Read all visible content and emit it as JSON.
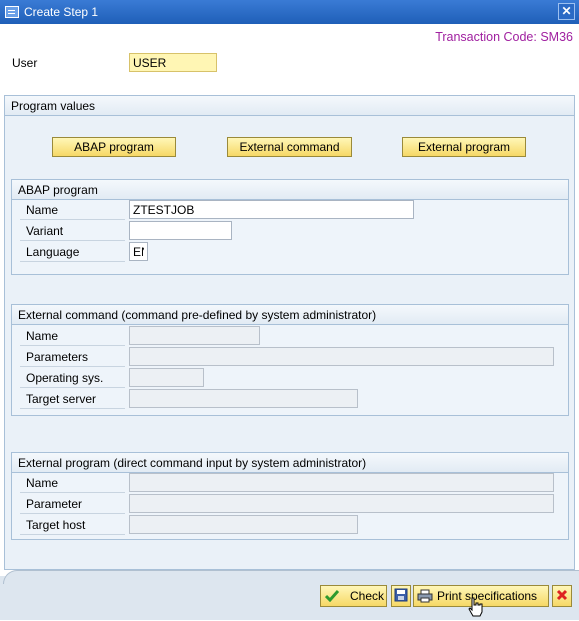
{
  "window": {
    "title": "Create Step  1",
    "close_glyph": "✕"
  },
  "transaction_code": "Transaction Code: SM36",
  "user": {
    "label": "User",
    "value": "USER"
  },
  "program_values": {
    "title": "Program values",
    "buttons": {
      "abap": "ABAP program",
      "external_command": "External command",
      "external_program": "External program"
    }
  },
  "abap_program": {
    "title": "ABAP program",
    "name_label": "Name",
    "name_value": "ZTESTJOB",
    "variant_label": "Variant",
    "variant_value": "",
    "language_label": "Language",
    "language_value": "EN"
  },
  "external_command": {
    "title": "External command (command pre-defined by system administrator)",
    "name_label": "Name",
    "parameters_label": "Parameters",
    "operating_sys_label": "Operating sys.",
    "target_server_label": "Target server"
  },
  "external_program": {
    "title": "External program (direct command input by system administrator)",
    "name_label": "Name",
    "parameter_label": "Parameter",
    "target_host_label": "Target host"
  },
  "footer": {
    "check_label": "Check",
    "print_label": "Print specifications",
    "icons": {
      "check": "check-icon",
      "save": "save-icon",
      "print": "print-icon",
      "cancel": "cancel-icon"
    }
  }
}
